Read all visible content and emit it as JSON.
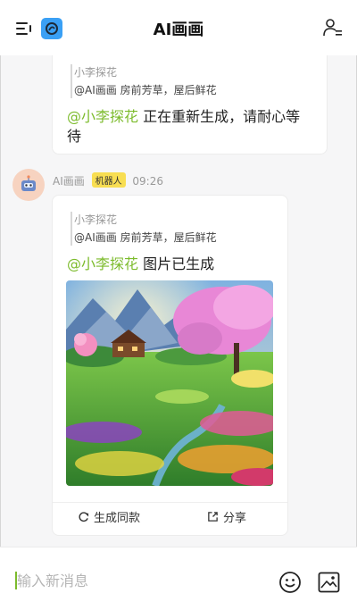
{
  "header": {
    "title": "AI画画"
  },
  "messages": [
    {
      "quote_name": "小李探花",
      "quote_text": "@AI画画 房前芳草，屋后鲜花",
      "mention": "@小李探花",
      "text_line1": " 正在重新生成，请耐心等",
      "text_line2": "待"
    },
    {
      "sender": "AI画画",
      "badge": "机器人",
      "time": "09:26",
      "quote_name": "小李探花",
      "quote_text": "@AI画画 房前芳草，屋后鲜花",
      "mention": "@小李探花",
      "text": " 图片已生成",
      "actions": {
        "regenerate": "生成同款",
        "share": "分享"
      }
    }
  ],
  "input": {
    "placeholder": "输入新消息"
  },
  "icons": {
    "menu": "menu-icon",
    "app": "app-logo-icon",
    "contacts": "user-list-icon",
    "avatar": "robot-avatar-icon",
    "regenerate": "refresh-icon",
    "share": "share-icon",
    "emoji": "emoji-icon",
    "image": "image-icon"
  },
  "colors": {
    "mention": "#7cbb2c",
    "app_icon": "#3aa0f5",
    "badge": "#f8de52",
    "avatar_bg": "#f7d3c0"
  }
}
